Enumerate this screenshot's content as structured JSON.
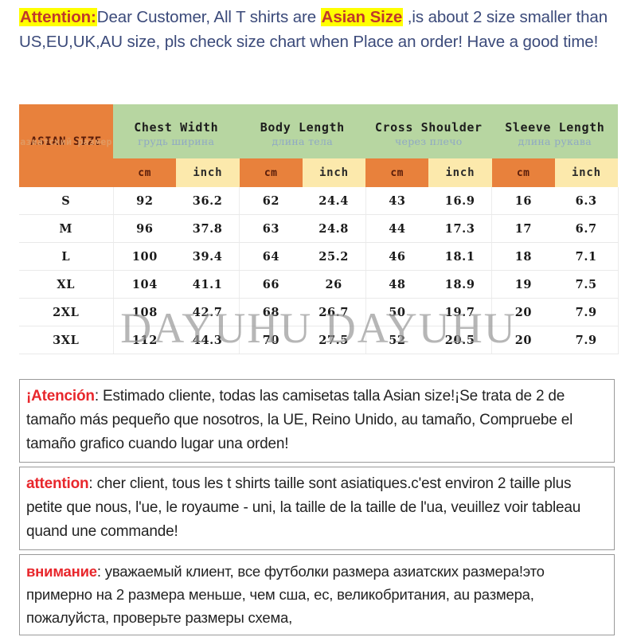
{
  "attention": {
    "lead_label": "Attention:",
    "text_part1": "Dear Customer, All T shirts are ",
    "highlight": "Asian Size",
    "text_part2": " ,is about 2 size smaller than US,EU,UK,AU size, pls check size chart when Place an order! Have a good time!"
  },
  "table": {
    "size_header": {
      "en": "ASIAN SIZE",
      "ru": "азиатский размер"
    },
    "groups": [
      {
        "en": "Chest Width",
        "ru": "грудь ширина"
      },
      {
        "en": "Body Length",
        "ru": "длина тела"
      },
      {
        "en": "Cross Shoulder",
        "ru": "через плечо"
      },
      {
        "en": "Sleeve Length",
        "ru": "длина рукава"
      }
    ],
    "units": {
      "cm": "cm",
      "inch": "inch"
    },
    "rows": [
      {
        "size": "S",
        "cells": [
          "92",
          "36.2",
          "62",
          "24.4",
          "43",
          "16.9",
          "16",
          "6.3"
        ]
      },
      {
        "size": "M",
        "cells": [
          "96",
          "37.8",
          "63",
          "24.8",
          "44",
          "17.3",
          "17",
          "6.7"
        ]
      },
      {
        "size": "L",
        "cells": [
          "100",
          "39.4",
          "64",
          "25.2",
          "46",
          "18.1",
          "18",
          "7.1"
        ]
      },
      {
        "size": "XL",
        "cells": [
          "104",
          "41.1",
          "66",
          "26",
          "48",
          "18.9",
          "19",
          "7.5"
        ]
      },
      {
        "size": "2XL",
        "cells": [
          "108",
          "42.7",
          "68",
          "26.7",
          "50",
          "19.7",
          "20",
          "7.9"
        ]
      },
      {
        "size": "3XL",
        "cells": [
          "112",
          "44.3",
          "70",
          "27.5",
          "52",
          "20.5",
          "20",
          "7.9"
        ]
      }
    ]
  },
  "watermark": {
    "text": "DAYUHU DAYUHU"
  },
  "notices": {
    "es": {
      "label": "¡Atención",
      "body": ": Estimado cliente, todas las camisetas talla Asian size!¡Se trata de 2 de tamaño más pequeño que nosotros, la UE, Reino Unido, au tamaño, Compruebe el tamaño grafico cuando lugar una orden!"
    },
    "fr": {
      "label": "attention",
      "body": ": cher client, tous les t shirts taille sont asiatiques.c'est environ 2 taille plus petite que nous, l'ue, le royaume - uni, la taille de la taille de l'ua, veuillez voir tableau quand une commande!"
    },
    "ru": {
      "label": "внимание",
      "body": ": уважаемый клиент, все футболки размера азиатских размера!это примерно на 2 размера меньше, чем сша, ес, великобритания, au размера, пожалуйста, проверьте размеры схема,"
    }
  },
  "colors": {
    "orange": "#e8813c",
    "green": "#b7d6a1",
    "cream": "#fce9ac",
    "red": "#e8272c",
    "highlight_yellow": "#ffff00",
    "body_blue": "#3b4a7a"
  }
}
